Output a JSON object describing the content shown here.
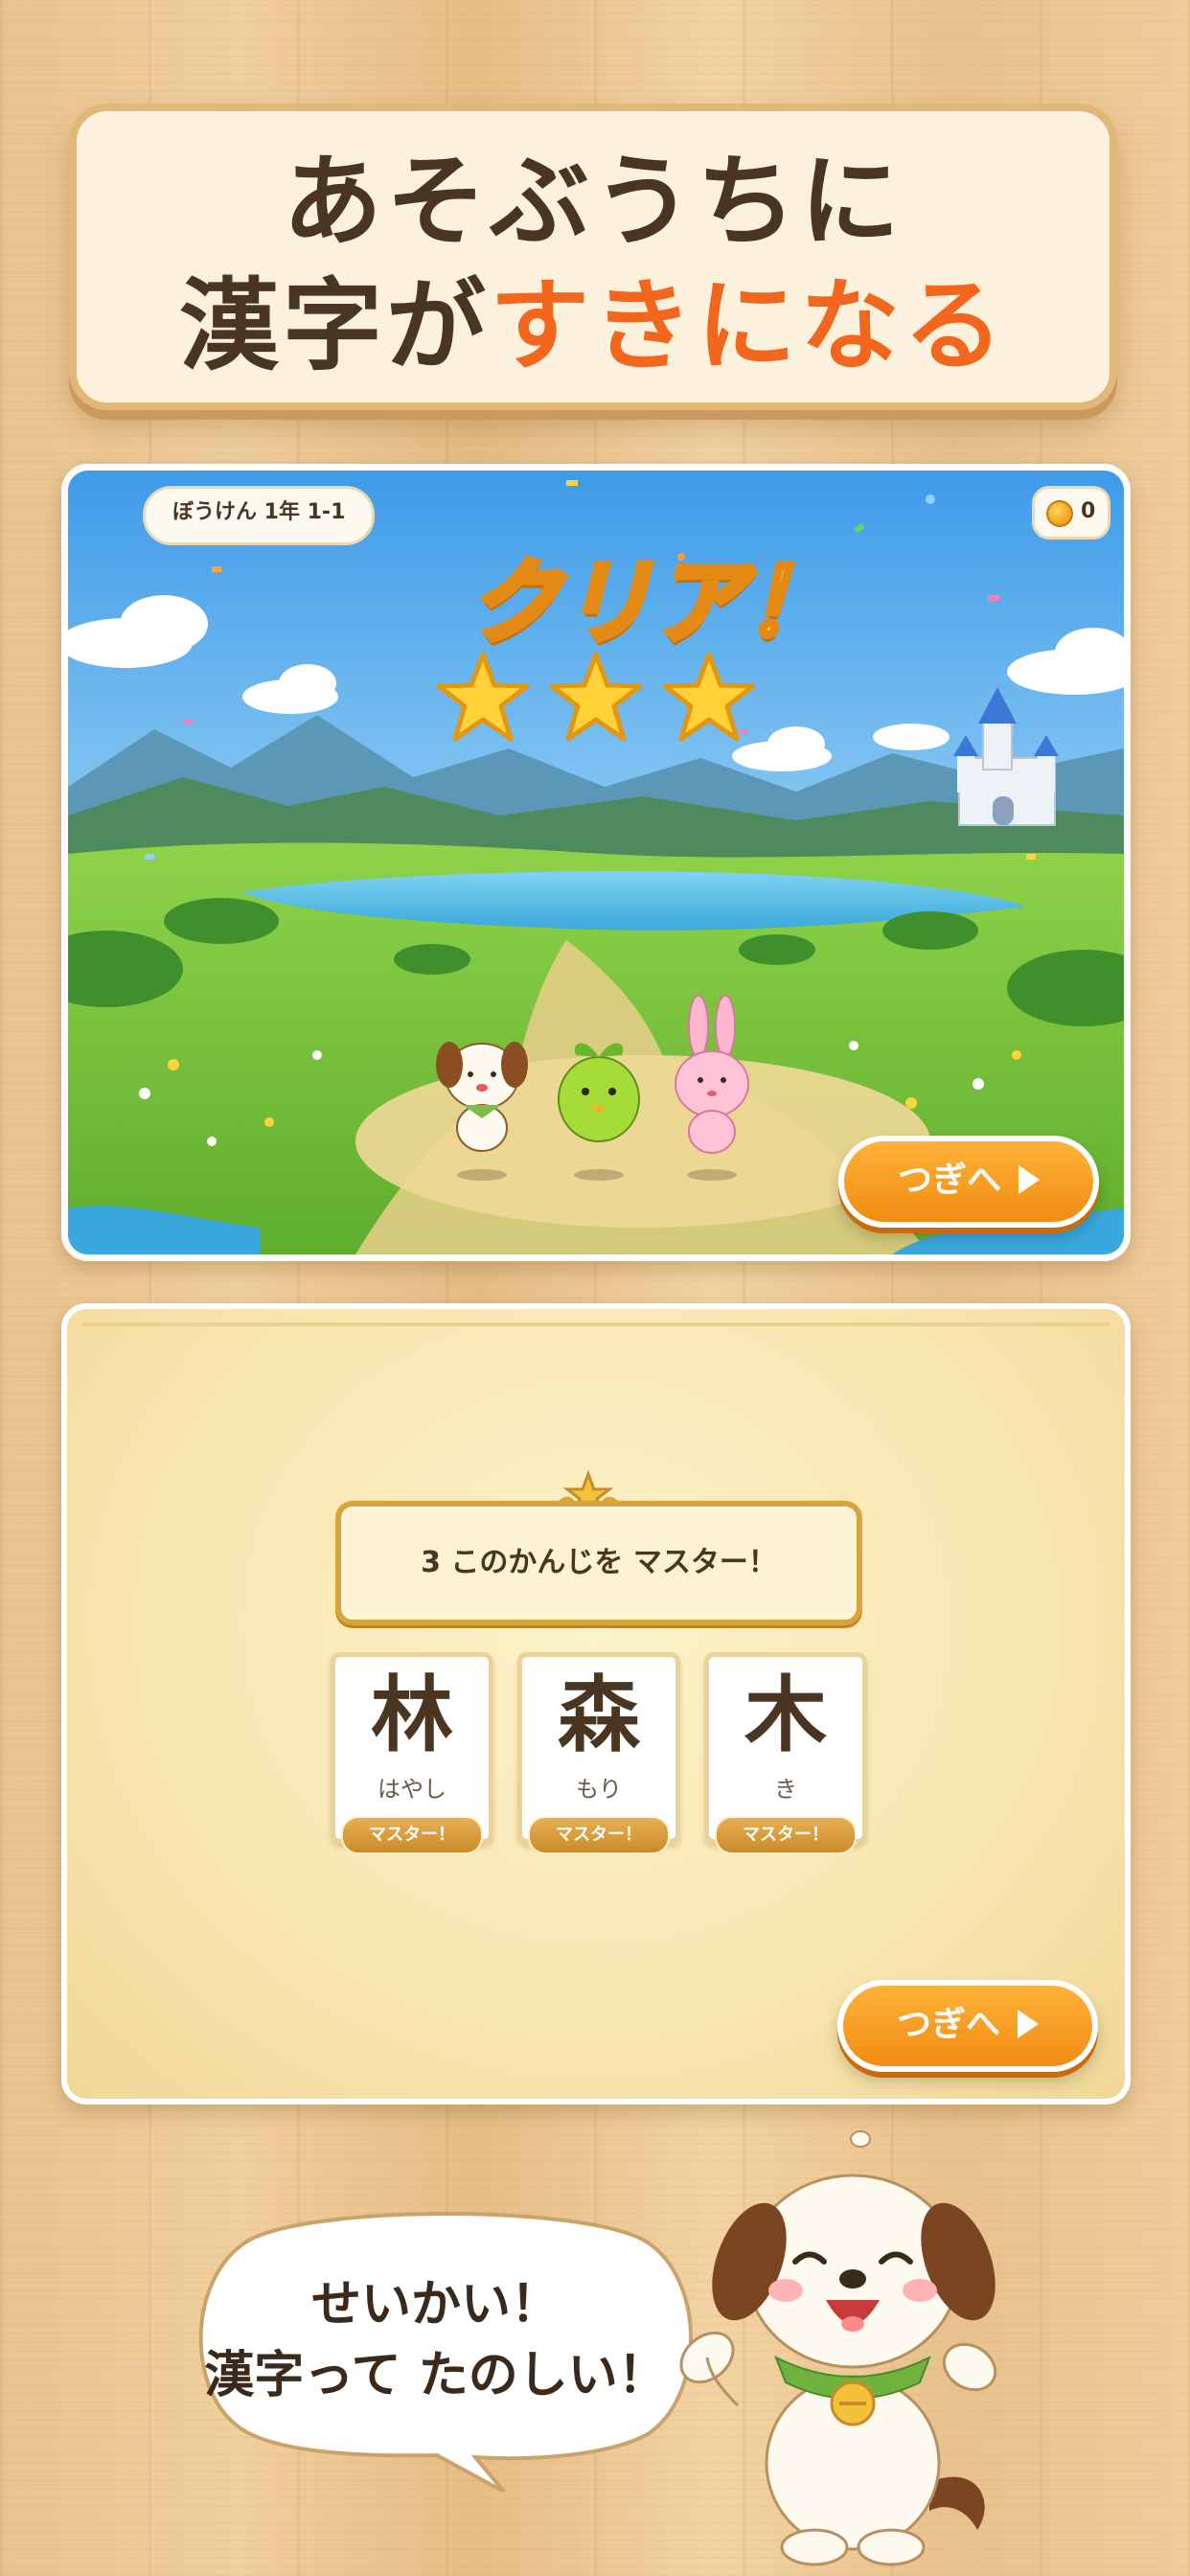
{
  "title": {
    "line1": "あそぶうちに",
    "line2_plain": "漢字が",
    "line2_accent": "すきになる"
  },
  "game": {
    "stage_label": "ぼうけん 1年 1-1",
    "coins": "0",
    "clear_text": "クリア！",
    "stars_earned": 3,
    "stars_total": 3,
    "next_label": "つぎへ"
  },
  "mastery": {
    "banner": "3 このかんじを マスター！",
    "kanji": [
      {
        "char": "林",
        "reading": "はやし",
        "badge": "マスター！"
      },
      {
        "char": "森",
        "reading": "もり",
        "badge": "マスター！"
      },
      {
        "char": "木",
        "reading": "き",
        "badge": "マスター！"
      }
    ],
    "next_label": "つぎへ"
  },
  "mascot": {
    "speech_line1": "せいかい！",
    "speech_line2": "漢字って たのしい！"
  },
  "colors": {
    "accent": "#f2661d",
    "button": "#f08c12",
    "text": "#4a3422"
  }
}
